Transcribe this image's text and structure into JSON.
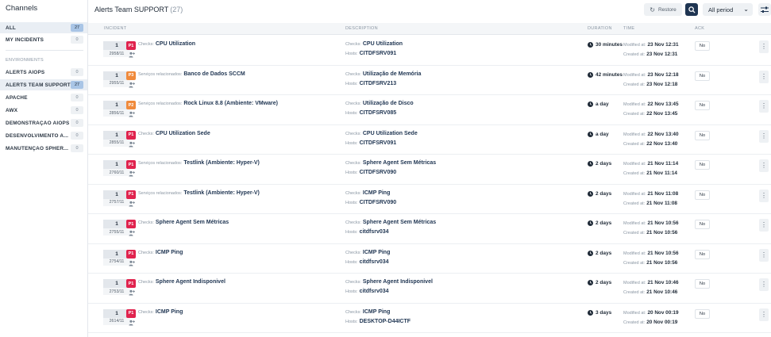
{
  "sidebar": {
    "title": "Channels",
    "top_items": [
      {
        "label": "ALL",
        "count": "27"
      },
      {
        "label": "MY INCIDENTS",
        "count": "0"
      }
    ],
    "section_label": "ENVIRONMENTS",
    "env_items": [
      {
        "label": "ALERTS AIOPS",
        "count": "0"
      },
      {
        "label": "ALERTS TEAM SUPPORT",
        "count": "27"
      },
      {
        "label": "APACHE",
        "count": "0"
      },
      {
        "label": "AWX",
        "count": "0"
      },
      {
        "label": "DEMONSTRAÇÃO AIOPS",
        "count": "0"
      },
      {
        "label": "DESENVOLVIMENTO A...",
        "count": "0"
      },
      {
        "label": "MANUTENÇAO SPHER...",
        "count": "0"
      }
    ]
  },
  "header": {
    "title": "Alerts Team SUPPORT",
    "count": "(27)",
    "restore_label": "Restore",
    "period_label": "All period"
  },
  "table": {
    "headers": {
      "incident": "INCIDENT",
      "description": "DESCRIPTION",
      "duration": "DURATION",
      "time": "TIME",
      "ack": "ACK"
    },
    "labels": {
      "checks": "Checks:",
      "related": "Serviços relacionados:",
      "hosts": "Hosts:",
      "modified": "Modified at:",
      "created": "Created at:"
    },
    "rows": [
      {
        "count": "1",
        "id": "2958/11",
        "priority": "P1",
        "prefix": "Checks:",
        "name": "CPU Utilization",
        "checks": "CPU Utilization",
        "hosts": "CITDFSRV091",
        "duration": "30 minutes",
        "modified": "23 Nov 12:31",
        "created": "23 Nov 12:31",
        "ack": "No"
      },
      {
        "count": "1",
        "id": "2955/11",
        "priority": "P3",
        "prefix": "Serviços relacionados:",
        "name": "Banco de Dados SCCM",
        "checks": "Utilização de Memória",
        "hosts": "CITDFSRV213",
        "duration": "42 minutes",
        "modified": "23 Nov 12:18",
        "created": "23 Nov 12:18",
        "ack": "No"
      },
      {
        "count": "1",
        "id": "2856/11",
        "priority": "P2",
        "prefix": "Serviços relacionados:",
        "name": "Rock Linux 8.8 (Ambiente: VMware)",
        "checks": "Utilização de Disco",
        "hosts": "CITDFSRV085",
        "duration": "a day",
        "modified": "22 Nov 13:45",
        "created": "22 Nov 13:45",
        "ack": "No"
      },
      {
        "count": "1",
        "id": "2855/11",
        "priority": "P1",
        "prefix": "Checks:",
        "name": "CPU Utilization Sede",
        "checks": "CPU Utilization Sede",
        "hosts": "CITDFSRV091",
        "duration": "a day",
        "modified": "22 Nov 13:40",
        "created": "22 Nov 13:40",
        "ack": "No"
      },
      {
        "count": "1",
        "id": "2760/11",
        "priority": "P1",
        "prefix": "Serviços relacionados:",
        "name": "Testlink (Ambiente: Hyper-V)",
        "checks": "Sphere Agent Sem Métricas",
        "hosts": "CITDFSRV090",
        "duration": "2 days",
        "modified": "21 Nov 11:14",
        "created": "21 Nov 11:14",
        "ack": "No"
      },
      {
        "count": "1",
        "id": "2757/11",
        "priority": "P1",
        "prefix": "Serviços relacionados:",
        "name": "Testlink (Ambiente: Hyper-V)",
        "checks": "ICMP Ping",
        "hosts": "CITDFSRV090",
        "duration": "2 days",
        "modified": "21 Nov 11:08",
        "created": "21 Nov 11:08",
        "ack": "No"
      },
      {
        "count": "1",
        "id": "2755/11",
        "priority": "P1",
        "prefix": "Checks:",
        "name": "Sphere Agent Sem Métricas",
        "checks": "Sphere Agent Sem Métricas",
        "hosts": "citdfsrv034",
        "duration": "2 days",
        "modified": "21 Nov 10:56",
        "created": "21 Nov 10:56",
        "ack": "No"
      },
      {
        "count": "1",
        "id": "2754/11",
        "priority": "P1",
        "prefix": "Checks:",
        "name": "ICMP Ping",
        "checks": "ICMP Ping",
        "hosts": "citdfsrv034",
        "duration": "2 days",
        "modified": "21 Nov 10:56",
        "created": "21 Nov 10:56",
        "ack": "No"
      },
      {
        "count": "1",
        "id": "2753/11",
        "priority": "P1",
        "prefix": "Checks:",
        "name": "Sphere Agent Indisponivel",
        "checks": "Sphere Agent Indisponivel",
        "hosts": "citdfsrv034",
        "duration": "2 days",
        "modified": "21 Nov 10:46",
        "created": "21 Nov 10:46",
        "ack": "No"
      },
      {
        "count": "1",
        "id": "2614/11",
        "priority": "P1",
        "prefix": "Checks:",
        "name": "ICMP Ping",
        "checks": "ICMP Ping",
        "hosts": "DESKTOP-D44ICTF",
        "duration": "3 days",
        "modified": "20 Nov 00:19",
        "created": "20 Nov 00:19",
        "ack": "No"
      }
    ]
  },
  "colors": {
    "P1": "#e0234e",
    "P2": "#f08a3c",
    "P3": "#f08a3c",
    "accent": "#1f3552",
    "active_count": "#a9c5e6"
  },
  "icons": {
    "restore": "restore-icon",
    "search": "search-icon",
    "chevron": "chevron-down-icon",
    "filter": "sliders-icon",
    "clock": "clock-icon",
    "user": "user-plus-icon",
    "kebab": "kebab-icon"
  }
}
